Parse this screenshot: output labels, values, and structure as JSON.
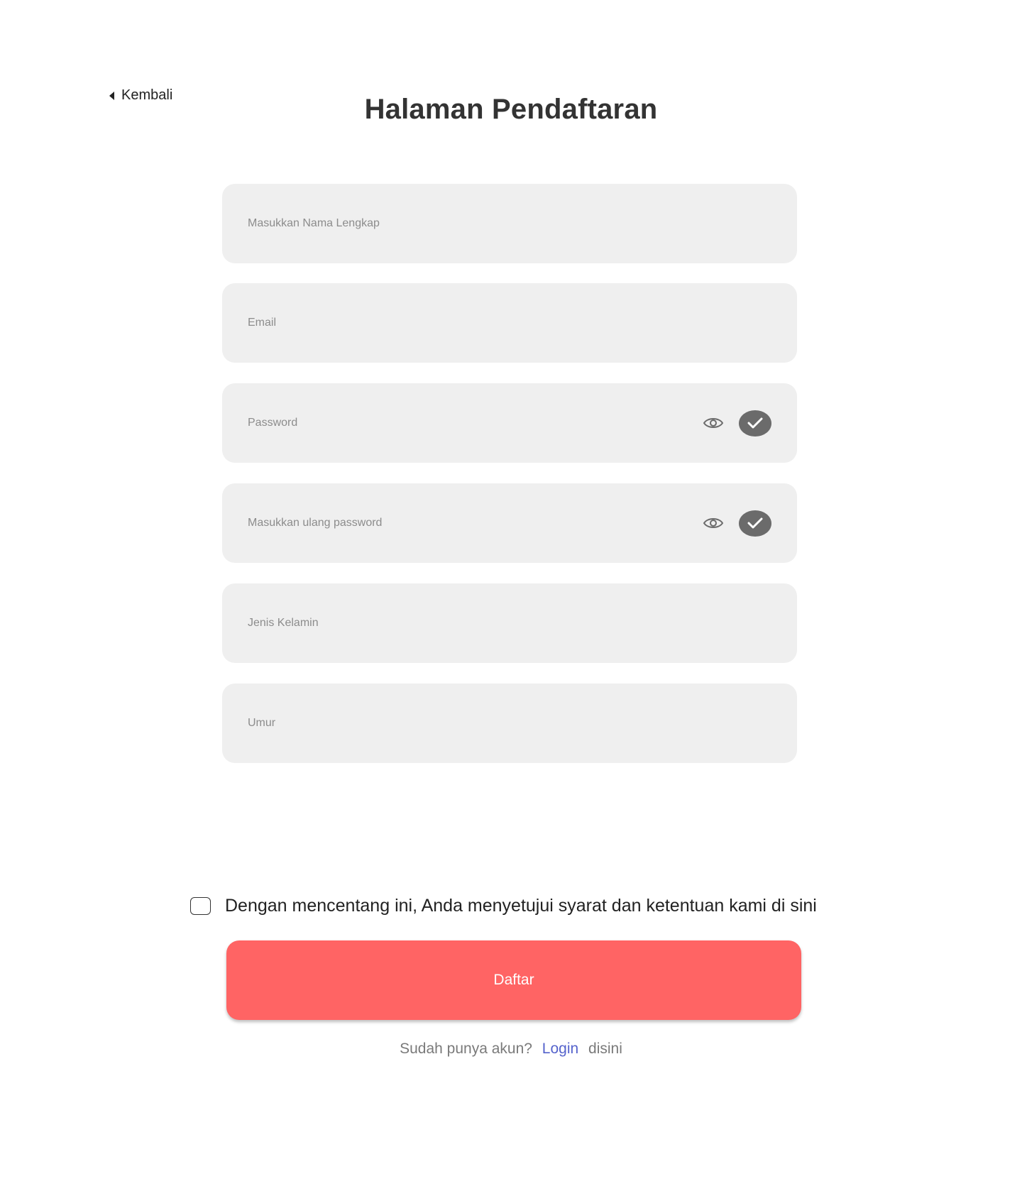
{
  "nav": {
    "back_label": "Kembali"
  },
  "header": {
    "title": "Halaman Pendaftaran"
  },
  "form": {
    "full_name": {
      "placeholder": "Masukkan Nama Lengkap",
      "value": ""
    },
    "email": {
      "placeholder": "Email",
      "value": ""
    },
    "password": {
      "placeholder": "Password",
      "value": ""
    },
    "confirm_password": {
      "placeholder": "Masukkan ulang password",
      "value": ""
    },
    "gender": {
      "placeholder": "Jenis Kelamin",
      "value": ""
    },
    "age": {
      "placeholder": "Umur",
      "value": ""
    }
  },
  "terms": {
    "checked": false,
    "label": "Dengan mencentang ini, Anda menyetujui syarat dan ketentuan kami di sini"
  },
  "submit": {
    "label": "Daftar"
  },
  "footer": {
    "prompt": "Sudah punya akun?",
    "login_link": "Login",
    "suffix": "disini"
  },
  "icons": {
    "back": "caret-left-icon",
    "show_password": "eye-icon",
    "valid": "check-circle-icon"
  },
  "colors": {
    "primary": "#ff6464",
    "field_bg": "#efefef",
    "link": "#5563cc",
    "check_bg": "#6b6b6b"
  }
}
